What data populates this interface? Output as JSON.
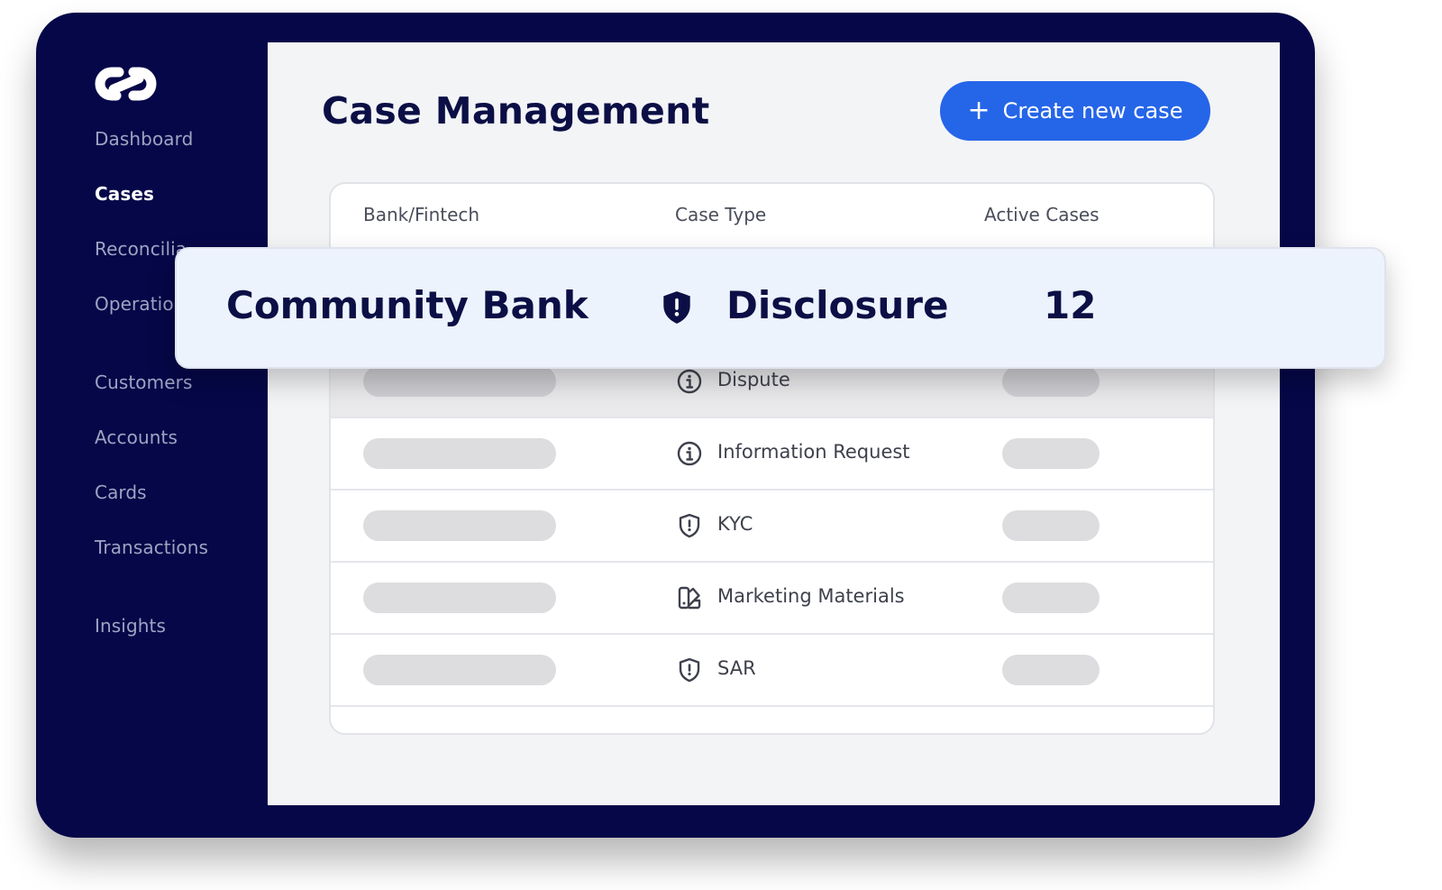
{
  "sidebar": {
    "items": [
      {
        "label": "Dashboard",
        "active": false
      },
      {
        "label": "Cases",
        "active": true
      },
      {
        "label": "Reconcilia",
        "active": false
      },
      {
        "label": "Operatio",
        "active": false
      },
      {
        "label": "Customers",
        "active": false
      },
      {
        "label": "Accounts",
        "active": false
      },
      {
        "label": "Cards",
        "active": false
      },
      {
        "label": "Transactions",
        "active": false
      },
      {
        "label": "Insights",
        "active": false
      }
    ]
  },
  "header": {
    "title": "Case Management",
    "create_button": {
      "icon": "plus-icon",
      "label": "Create new case"
    }
  },
  "table": {
    "columns": [
      "Bank/Fintech",
      "Case Type",
      "Active Cases"
    ],
    "rows": [
      {
        "case_type": "Dispute",
        "icon": "info-icon"
      },
      {
        "case_type": "Information Request",
        "icon": "info-icon"
      },
      {
        "case_type": "KYC",
        "icon": "shield-alert-icon"
      },
      {
        "case_type": "Marketing Materials",
        "icon": "swatch-book-icon"
      },
      {
        "case_type": "SAR",
        "icon": "shield-alert-icon"
      }
    ]
  },
  "highlight": {
    "bank": "Community Bank",
    "case_type": "Disclosure",
    "icon": "shield-alert-filled-icon",
    "active_cases": "12"
  },
  "colors": {
    "frame": "#050748",
    "accent": "#2565e8",
    "highlight_bg": "#edf3fd",
    "title": "#0b0f45"
  }
}
